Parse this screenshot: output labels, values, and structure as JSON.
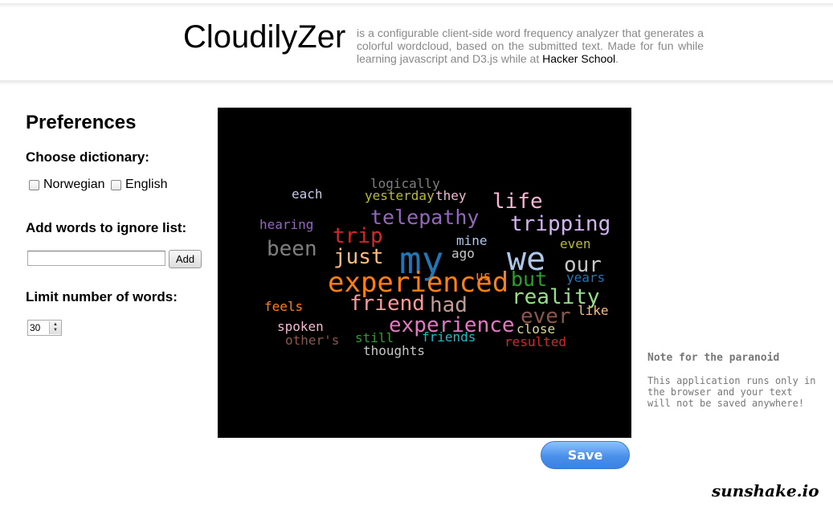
{
  "header": {
    "app_title": "CloudilyZer",
    "tagline_text": "is a configurable client-side word frequency analyzer that generates a colorful wordcloud, based on the submitted text. Made for fun while learning javascript and D3.js while at ",
    "tagline_link": "Hacker School",
    "tagline_end": "."
  },
  "preferences": {
    "title": "Preferences",
    "dictionary_label": "Choose dictionary:",
    "dictionary_options": [
      {
        "label": "Norwegian",
        "checked": false
      },
      {
        "label": "English",
        "checked": false
      }
    ],
    "ignore_label": "Add words to ignore list:",
    "ignore_input_value": "",
    "add_button_label": "Add",
    "limit_label": "Limit number of words:",
    "limit_value": "30"
  },
  "wordcloud": {
    "background": "#000000",
    "words": [
      {
        "text": "logically",
        "color": "#7f7f7f"
      },
      {
        "text": "each",
        "color": "#c7c7e8"
      },
      {
        "text": "yesterday",
        "color": "#bcbd22"
      },
      {
        "text": "they",
        "color": "#f7b6d2"
      },
      {
        "text": "life",
        "color": "#f7b6d2"
      },
      {
        "text": "telepathy",
        "color": "#9467bd"
      },
      {
        "text": "tripping",
        "color": "#d2b4f0"
      },
      {
        "text": "hearing",
        "color": "#9467bd"
      },
      {
        "text": "trip",
        "color": "#d62728"
      },
      {
        "text": "mine",
        "color": "#aec7e8"
      },
      {
        "text": "even",
        "color": "#bcbd22"
      },
      {
        "text": "been",
        "color": "#7f7f7f"
      },
      {
        "text": "just",
        "color": "#ffbb78"
      },
      {
        "text": "my",
        "color": "#1f77b4"
      },
      {
        "text": "ago",
        "color": "#c7c7c7"
      },
      {
        "text": "we",
        "color": "#aec7e8"
      },
      {
        "text": "our",
        "color": "#c7c7c7"
      },
      {
        "text": "us",
        "color": "#ff7f0e"
      },
      {
        "text": "but",
        "color": "#2ca02c"
      },
      {
        "text": "years",
        "color": "#1f77b4"
      },
      {
        "text": "experienced",
        "color": "#ff7f0e"
      },
      {
        "text": "reality",
        "color": "#98df8a"
      },
      {
        "text": "friend",
        "color": "#ff9896"
      },
      {
        "text": "had",
        "color": "#c49c94"
      },
      {
        "text": "feels",
        "color": "#ff7f0e"
      },
      {
        "text": "ever",
        "color": "#8c564b"
      },
      {
        "text": "like",
        "color": "#ffbb78"
      },
      {
        "text": "experience",
        "color": "#e377c2"
      },
      {
        "text": "spoken",
        "color": "#f7b6d2"
      },
      {
        "text": "close",
        "color": "#dbdb8d"
      },
      {
        "text": "other's",
        "color": "#8c564b"
      },
      {
        "text": "still",
        "color": "#2ca02c"
      },
      {
        "text": "friends",
        "color": "#17becf"
      },
      {
        "text": "resulted",
        "color": "#d62728"
      },
      {
        "text": "thoughts",
        "color": "#c7c7c7"
      }
    ]
  },
  "save_button_label": "Save",
  "note": {
    "title": "Note for the paranoid",
    "body": "This application runs only in the browser and your text will not be saved anywhere!"
  },
  "footer": {
    "logo_text": "sunshake.io"
  }
}
